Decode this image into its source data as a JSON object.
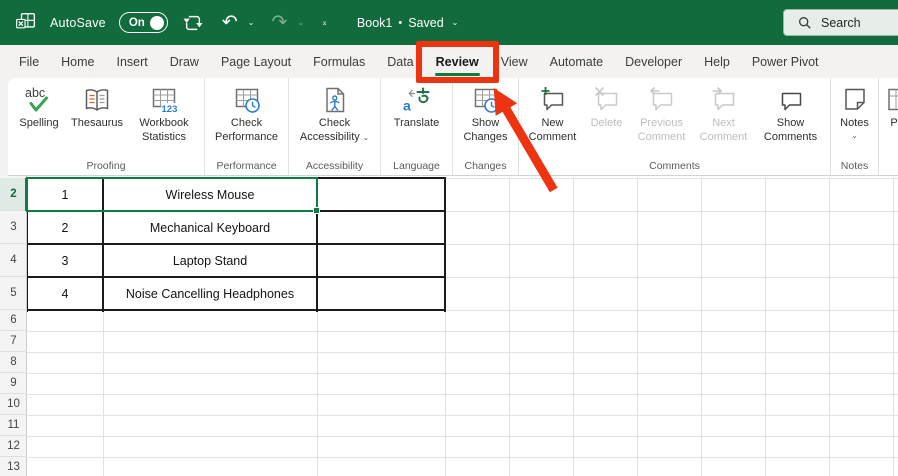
{
  "titlebar": {
    "autosave_label": "AutoSave",
    "autosave_state": "On",
    "workbook_name": "Book1",
    "separator": "•",
    "save_status": "Saved",
    "search_label": "Search"
  },
  "tabs": {
    "items": [
      "File",
      "Home",
      "Insert",
      "Draw",
      "Page Layout",
      "Formulas",
      "Data",
      "Review",
      "View",
      "Automate",
      "Developer",
      "Help",
      "Power Pivot"
    ],
    "active": "Review"
  },
  "ribbon": {
    "groups": [
      {
        "label": "Proofing",
        "buttons": [
          {
            "name": "spelling",
            "icon": "spelling",
            "lines": [
              "Spelling"
            ]
          },
          {
            "name": "thesaurus",
            "icon": "thesaurus",
            "lines": [
              "Thesaurus"
            ]
          },
          {
            "name": "workbook-statistics",
            "icon": "workbook-statistics",
            "lines": [
              "Workbook",
              "Statistics"
            ]
          }
        ]
      },
      {
        "label": "Performance",
        "buttons": [
          {
            "name": "check-performance",
            "icon": "sheet-clock",
            "lines": [
              "Check",
              "Performance"
            ]
          }
        ]
      },
      {
        "label": "Accessibility",
        "buttons": [
          {
            "name": "check-accessibility",
            "icon": "accessibility",
            "lines": [
              "Check",
              "Accessibility"
            ],
            "dropdown": true
          }
        ]
      },
      {
        "label": "Language",
        "buttons": [
          {
            "name": "translate",
            "icon": "translate",
            "lines": [
              "Translate"
            ]
          }
        ]
      },
      {
        "label": "Changes",
        "buttons": [
          {
            "name": "show-changes",
            "icon": "sheet-clock",
            "lines": [
              "Show",
              "Changes"
            ]
          }
        ]
      },
      {
        "label": "Comments",
        "buttons": [
          {
            "name": "new-comment",
            "icon": "comment-plus",
            "lines": [
              "New",
              "Comment"
            ]
          },
          {
            "name": "delete-comment",
            "icon": "comment-x",
            "lines": [
              "Delete"
            ],
            "disabled": true
          },
          {
            "name": "previous-comment",
            "icon": "comment-prev",
            "lines": [
              "Previous",
              "Comment"
            ],
            "disabled": true
          },
          {
            "name": "next-comment",
            "icon": "comment-next",
            "lines": [
              "Next",
              "Comment"
            ],
            "disabled": true
          },
          {
            "name": "show-comments",
            "icon": "comment",
            "lines": [
              "Show",
              "Comments"
            ]
          }
        ]
      },
      {
        "label": "Notes",
        "buttons": [
          {
            "name": "notes",
            "icon": "note",
            "lines": [
              "Notes"
            ],
            "dropdown_below": true
          }
        ]
      },
      {
        "label": "",
        "cut": true,
        "buttons": [
          {
            "name": "protect-partial",
            "icon": "sheet-partial",
            "lines": [
              "P"
            ]
          }
        ]
      }
    ]
  },
  "sheet": {
    "row_numbers": [
      "2",
      "3",
      "4",
      "5",
      "6",
      "7",
      "8",
      "9",
      "10",
      "11",
      "12",
      "13"
    ],
    "rows": [
      {
        "cells": [
          "1",
          "Wireless Mouse",
          ""
        ]
      },
      {
        "cells": [
          "2",
          "Mechanical Keyboard",
          ""
        ]
      },
      {
        "cells": [
          "3",
          "Laptop Stand",
          ""
        ]
      },
      {
        "cells": [
          "4",
          "Noise Cancelling Headphones",
          ""
        ]
      }
    ],
    "selection": "A2:B2"
  },
  "annotation": {
    "shape": "box-and-arrow",
    "target_tab": "Review",
    "color": "#ee3311"
  },
  "colors": {
    "titlebar_green": "#116b3d",
    "accent_green": "#107c41",
    "annotation_red": "#ee3311",
    "icon_blue": "#2b7cd3",
    "icon_green": "#217346"
  }
}
